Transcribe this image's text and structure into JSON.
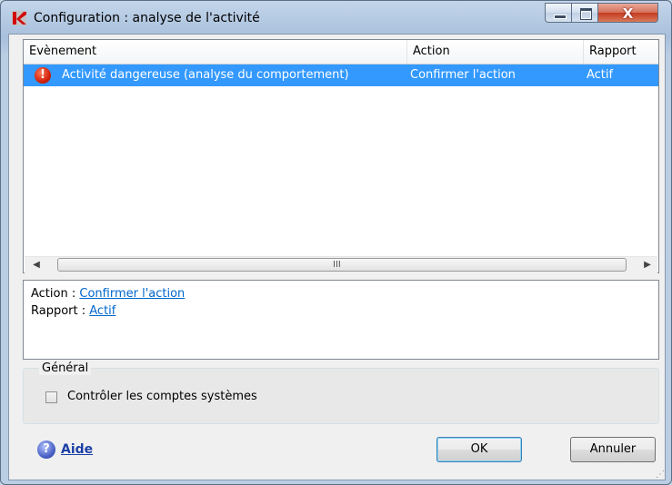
{
  "window": {
    "title": "Configuration : analyse de l'activité",
    "controls": {
      "close_glyph": "X"
    }
  },
  "table": {
    "columns": [
      "Evènement",
      "Action",
      "Rapport"
    ],
    "rows": [
      {
        "event": "Activité dangereuse (analyse du comportement)",
        "action": "Confirmer l'action",
        "report": "Actif",
        "selected": true
      }
    ],
    "scroll_grip": "III"
  },
  "details": {
    "action_label": "Action :",
    "action_value": "Confirmer l'action",
    "report_label": "Rapport :",
    "report_value": "Actif"
  },
  "general": {
    "legend": "Général",
    "checkbox_label": "Contrôler les comptes systèmes",
    "checked": false
  },
  "footer": {
    "help": "Aide",
    "ok": "OK",
    "cancel": "Annuler"
  },
  "colors": {
    "selection": "#3399ff",
    "link": "#0066cc",
    "accent_red": "#d2210a"
  }
}
